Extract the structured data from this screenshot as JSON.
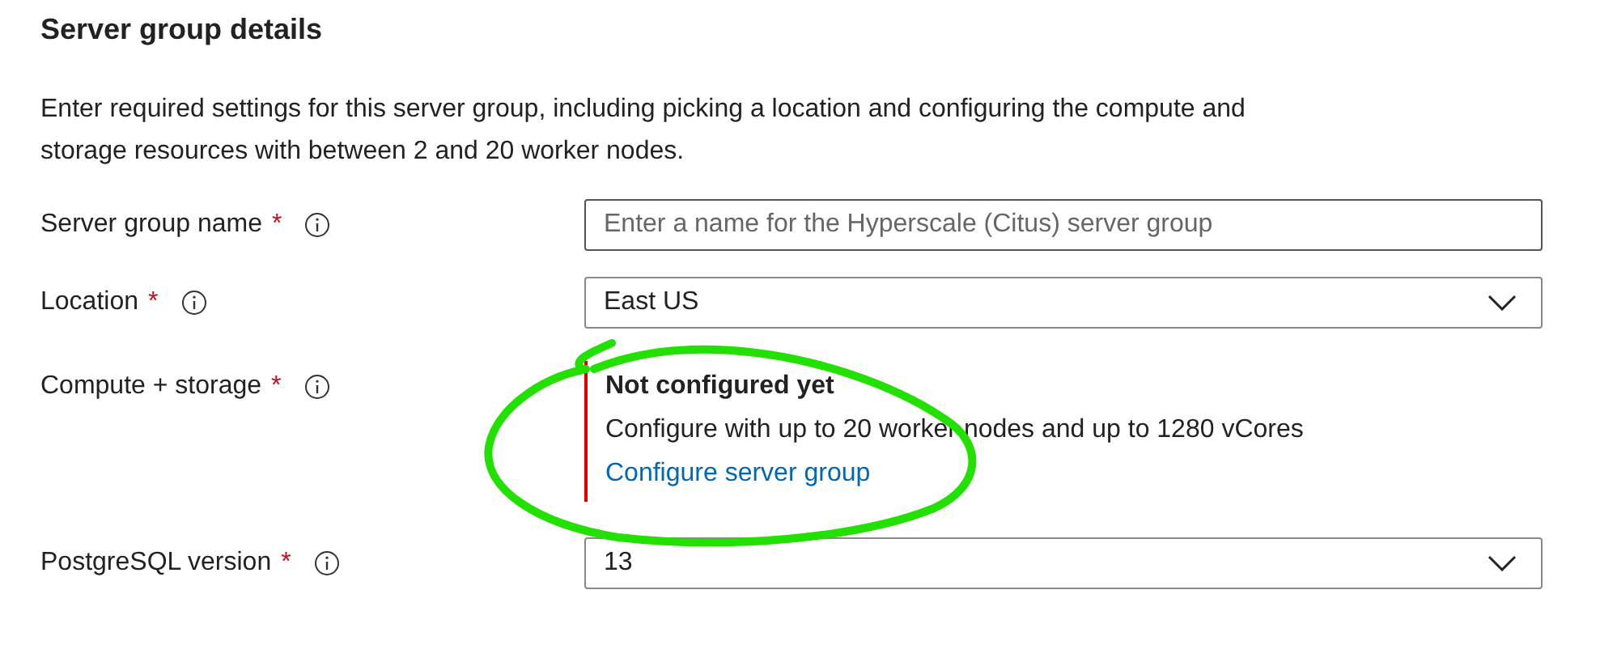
{
  "section": {
    "title": "Server group details",
    "description": "Enter required settings for this server group, including picking a location and configuring the compute and storage resources with between 2 and 20 worker nodes."
  },
  "fields": [
    {
      "kind": "text",
      "label": "Server group name",
      "required_mark": "*",
      "placeholder": "Enter a name for the Hyperscale (Citus) server group"
    },
    {
      "kind": "select",
      "label": "Location",
      "required_mark": "*",
      "value": "East US"
    },
    {
      "kind": "summary",
      "label": "Compute + storage",
      "required_mark": "*",
      "status": "Not configured yet",
      "detail": "Configure with up to 20 worker nodes and up to 1280 vCores",
      "link": "Configure server group",
      "error": true
    },
    {
      "kind": "select",
      "label": "PostgreSQL version",
      "required_mark": "*",
      "value": "13"
    }
  ]
}
